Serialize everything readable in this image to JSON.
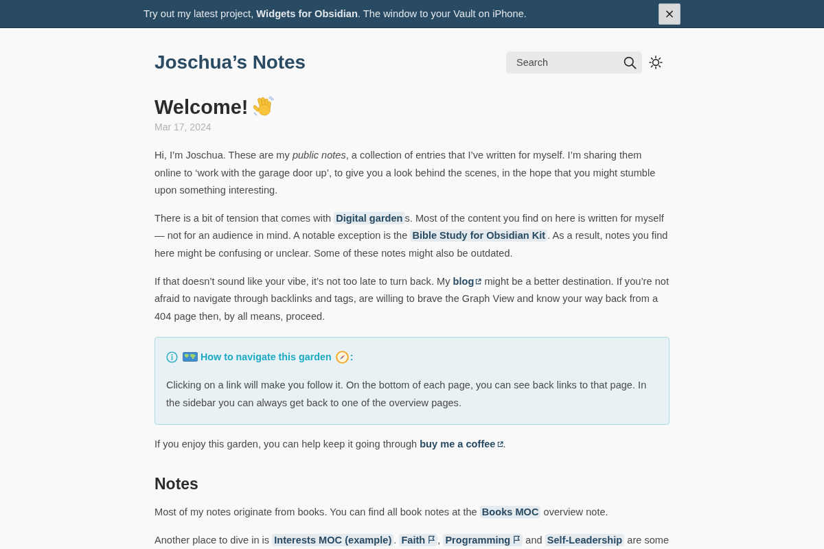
{
  "banner": {
    "segments": [
      {
        "kind": "text",
        "text": "Try out my latest project, "
      },
      {
        "kind": "link",
        "text": "Widgets for Obsidian"
      },
      {
        "kind": "text",
        "text": ". The window to your Vault on iPhone."
      }
    ],
    "close_label": "×"
  },
  "header": {
    "site_title": "Joschua’s Notes",
    "search": {
      "placeholder": "Search"
    }
  },
  "article": {
    "title": "Welcome!",
    "date": "Mar 17, 2024",
    "blocks": [
      {
        "kind": "paragraph",
        "segments": [
          {
            "kind": "text",
            "text": "Hi, I’m Joschua. These are my *public notes*, a collection of entries that I’ve written for myself. I’m sharing them online to ‘work with the garage door up’, to give you a look behind the scenes, in the hope that you might stumble upon something interesting."
          }
        ]
      },
      {
        "kind": "paragraph",
        "segments": [
          {
            "kind": "text",
            "text": "There is a bit of tension that comes with "
          },
          {
            "kind": "link",
            "text": "Digital garden",
            "flagged": false
          },
          {
            "kind": "text",
            "text": "s. Most of the content you find on here is written for myself — not for an audience in mind. A notable exception is the "
          },
          {
            "kind": "link",
            "text": "Bible Study for Obsidian Kit",
            "flagged": false
          },
          {
            "kind": "text",
            "text": ". As a result, notes you find here might be confusing or unclear. Some of these notes might also be outdated."
          }
        ]
      },
      {
        "kind": "paragraph",
        "segments": [
          {
            "kind": "text",
            "text": "If that doesn’t sound like your vibe, it’s not too late to turn back. My "
          },
          {
            "kind": "external_link",
            "text": "blog"
          },
          {
            "kind": "text",
            "text": " might be a better destination. If you’re not afraid to navigate through backlinks and tags, are willing to brave the Graph View and know your way back from a 404 page then, by all means, proceed."
          }
        ]
      },
      {
        "kind": "callout",
        "title": "How to navigate this garden",
        "title_end": ":",
        "segments": [
          {
            "kind": "text",
            "text": "Clicking on a link will make you follow it. On the bottom of each page, you can see back links to that page. In the sidebar you can always get back to one of the overview pages."
          }
        ]
      },
      {
        "kind": "paragraph",
        "segments": [
          {
            "kind": "text",
            "text": "If you enjoy this garden, you can help keep it going through "
          },
          {
            "kind": "external_link",
            "text": "buy me a coffee"
          },
          {
            "kind": "text",
            "text": "."
          }
        ]
      },
      {
        "kind": "heading",
        "text": "Notes"
      },
      {
        "kind": "paragraph",
        "segments": [
          {
            "kind": "text",
            "text": "Most of my notes originate from books. You can find all book notes at the "
          },
          {
            "kind": "link",
            "text": "Books MOC",
            "flagged": false
          },
          {
            "kind": "text",
            "text": " overview note."
          }
        ]
      },
      {
        "kind": "paragraph",
        "segments": [
          {
            "kind": "text",
            "text": "Another place to dive in is "
          },
          {
            "kind": "link",
            "text": "Interests MOC (example)",
            "flagged": false
          },
          {
            "kind": "text",
            "text": ". "
          },
          {
            "kind": "link",
            "text": "Faith",
            "flagged": true
          },
          {
            "kind": "text",
            "text": ", "
          },
          {
            "kind": "link",
            "text": "Programming",
            "flagged": true
          },
          {
            "kind": "text",
            "text": " and "
          },
          {
            "kind": "link",
            "text": "Self-Leadership",
            "flagged": false
          },
          {
            "kind": "text",
            "text": " are some"
          }
        ]
      }
    ]
  }
}
